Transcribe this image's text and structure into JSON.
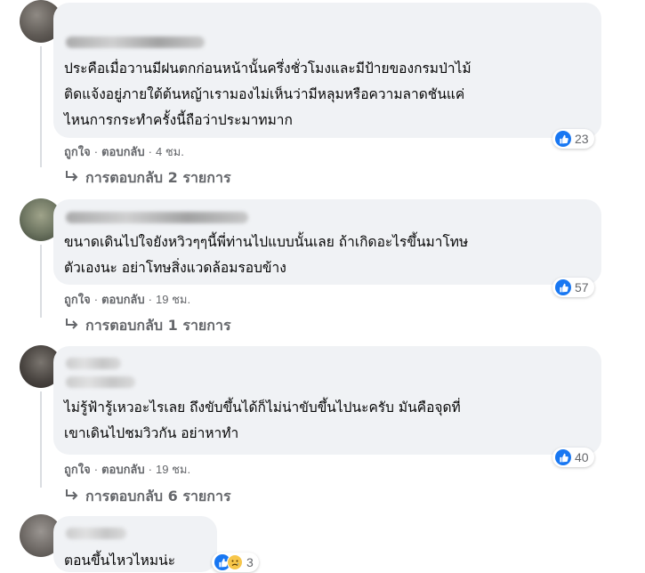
{
  "comments": [
    {
      "lines": [
        "ประคือเมื่อวานมีฝนตกก่อนหน้านั้นครึ่งชั่วโมงและมีป้ายของกรมป่าไม้",
        "ติดแจ้งอยู่ภายใต้ต้นหญ้าเรามองไม่เห็นว่ามีหลุมหรือความลาดชันแค่",
        "ไหนการกระทำครั้งนี้ถือว่าประมาทมาก"
      ],
      "like": "ถูกใจ",
      "reply": "ตอบกลับ",
      "time": "4 ชม.",
      "reactions": "23",
      "replies_link": "การตอบกลับ 2 รายการ"
    },
    {
      "lines": [
        "ขนาดเดินไปใจยังหวิวๆๆนี้พี่ท่านไปแบบนั้นเลย ถ้าเกิดอะไรขึ้นมาโทษ",
        "ตัวเองนะ อย่าโทษสิ่งแวดล้อมรอบข้าง"
      ],
      "like": "ถูกใจ",
      "reply": "ตอบกลับ",
      "time": "19 ชม.",
      "reactions": "57",
      "replies_link": "การตอบกลับ 1 รายการ"
    },
    {
      "lines": [
        "ไม่รู้ฟ้ารู้เหวอะไรเลย ถึงขับขึ้นได้ก็ไม่น่าขับขึ้นไปนะครับ มันคือจุดที่",
        "เขาเดินไปชมวิวกัน อย่าหาทำ"
      ],
      "like": "ถูกใจ",
      "reply": "ตอบกลับ",
      "time": "19 ชม.",
      "reactions": "40",
      "replies_link": "การตอบกลับ 6 รายการ"
    },
    {
      "lines": [
        "ตอนขึ้นไหวไหมน่ะ"
      ],
      "reactions": "3"
    }
  ],
  "colors": {
    "like_blue": "#1877f2",
    "bubble": "#f0f2f5",
    "meta": "#65676b",
    "sad_yellow": "#f7c64a"
  },
  "icons": {
    "like": "thumbs-up-icon",
    "sad": "sad-face-icon",
    "reply_arrow": "reply-arrow-icon"
  }
}
